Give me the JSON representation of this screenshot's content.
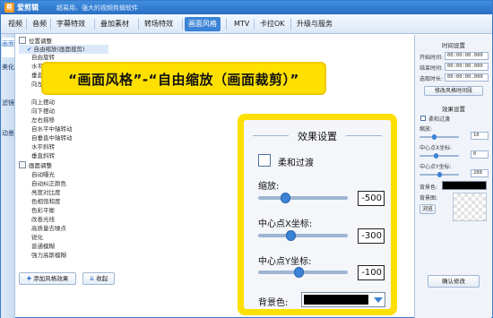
{
  "titlebar": {
    "logo": "剪",
    "app_name": "爱剪辑",
    "slogan": "超易用、强大的视频剪辑软件"
  },
  "menu": [
    {
      "label": "视频",
      "active": false
    },
    {
      "label": "音频",
      "active": false
    },
    {
      "label": "字幕特效",
      "active": false
    },
    {
      "label": "叠加素材",
      "active": false
    },
    {
      "label": "转场特效",
      "active": false
    },
    {
      "label": "画面风格",
      "active": true
    },
    {
      "label": "MTV",
      "active": false
    },
    {
      "label": "卡拉OK",
      "active": false
    },
    {
      "label": "升级与服务",
      "active": false
    }
  ],
  "side_tabs": [
    "画面",
    "美化",
    "滤镜",
    "动景"
  ],
  "tree": {
    "group_position": "位置调整",
    "position_items": [
      "自由缩放(画面裁剪)",
      "自由旋转",
      "水平翻转",
      "垂直翻转",
      "向左摆动",
      "向上摆动",
      "向下摆动",
      "左右摇移",
      "自水平中轴转动",
      "自垂直中轴转动",
      "水平斜转",
      "垂直斜转"
    ],
    "group_adjust": "画面调整",
    "adjust_items": [
      "自动曝光",
      "自动纠正颜色",
      "亮度对比度",
      "色相饱和度",
      "色彩平衡",
      "改善光线",
      "高质量去噪点",
      "锐化",
      "普通模糊",
      "强力高斯模糊"
    ]
  },
  "bottom": {
    "add_button": "添加风格效果",
    "collapse_button": "收起",
    "confirm_button": "确认修改"
  },
  "right_panel": {
    "time_heading": "时间设置",
    "start_label": "开始时间:",
    "start_value": "00:00:00.000",
    "end_label": "结束时间:",
    "end_value": "00:00:00.000",
    "duration_label": "选取时长:",
    "duration_value": "00:00:00.000",
    "modify_time_button": "修改风格时间段",
    "effect_heading": "效果设置",
    "smooth_label": "柔和过渡",
    "zoom_label": "缩放:",
    "zoom_value": "10",
    "cx_label": "中心点X坐标:",
    "cx_value": "0",
    "cy_label": "中心点Y坐标:",
    "cy_value": "288",
    "bg_label": "背景色:",
    "bg_image_label": "背景图:",
    "browse_button": "浏览"
  },
  "callout": {
    "text": "“画面风格”-“自由缩放（画面裁剪）”"
  },
  "zoom_panel": {
    "title": "效果设置",
    "smooth_label": "柔和过渡",
    "scale_label": "缩放:",
    "scale_value": "-500",
    "scale_level": 0.3,
    "cx_label": "中心点X坐标:",
    "cx_value": "-300",
    "cx_level": 0.36,
    "cy_label": "中心点Y坐标:",
    "cy_value": "-100",
    "cy_level": 0.45,
    "bg_label": "背景色:",
    "bg_color": "#000000"
  },
  "colors": {
    "accent": "#3b83d6",
    "callout": "#fde000"
  }
}
